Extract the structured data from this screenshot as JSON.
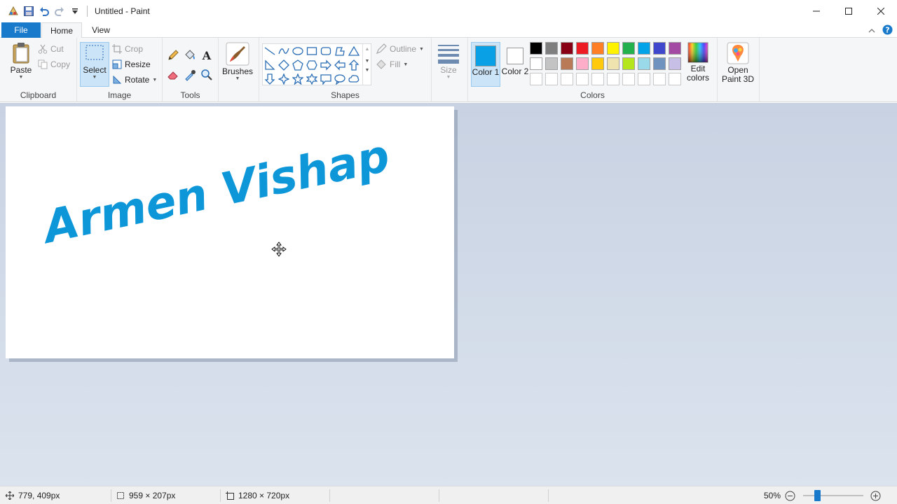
{
  "window": {
    "title": "Untitled - Paint"
  },
  "tabs": [
    {
      "label": "File"
    },
    {
      "label": "Home"
    },
    {
      "label": "View"
    }
  ],
  "ribbon": {
    "clipboard": {
      "group_label": "Clipboard",
      "paste_label": "Paste",
      "cut_label": "Cut",
      "copy_label": "Copy"
    },
    "image": {
      "group_label": "Image",
      "select_label": "Select",
      "crop_label": "Crop",
      "resize_label": "Resize",
      "rotate_label": "Rotate"
    },
    "tools": {
      "group_label": "Tools"
    },
    "brushes": {
      "label": "Brushes"
    },
    "shapes": {
      "group_label": "Shapes",
      "outline_label": "Outline",
      "fill_label": "Fill"
    },
    "size": {
      "label": "Size"
    },
    "colors": {
      "group_label": "Colors",
      "color1_label": "Color 1",
      "color1_value": "#0aa0e6",
      "color2_label": "Color 2",
      "color2_value": "#ffffff",
      "palette_row1": [
        "#000000",
        "#7f7f7f",
        "#880015",
        "#ed1c24",
        "#ff7f27",
        "#fff200",
        "#22b14c",
        "#00a2e8",
        "#3f48cc",
        "#a349a4"
      ],
      "palette_row2": [
        "#ffffff",
        "#c3c3c3",
        "#b97a57",
        "#ffaec9",
        "#ffc90e",
        "#efe4b0",
        "#b5e61d",
        "#99d9ea",
        "#7092be",
        "#c8bfe7"
      ],
      "palette_row3": [
        "#ffffff",
        "#ffffff",
        "#ffffff",
        "#ffffff",
        "#ffffff",
        "#ffffff",
        "#ffffff",
        "#ffffff",
        "#ffffff",
        "#ffffff"
      ],
      "edit_colors_label": "Edit colors"
    },
    "paint3d": {
      "label": "Open Paint 3D"
    }
  },
  "canvas": {
    "text": "Armen Vishap",
    "text_color": "#0e97d8"
  },
  "statusbar": {
    "cursor_pos": "779, 409px",
    "selection_size": "959 × 207px",
    "image_size": "1280 × 720px",
    "zoom": "50%"
  }
}
